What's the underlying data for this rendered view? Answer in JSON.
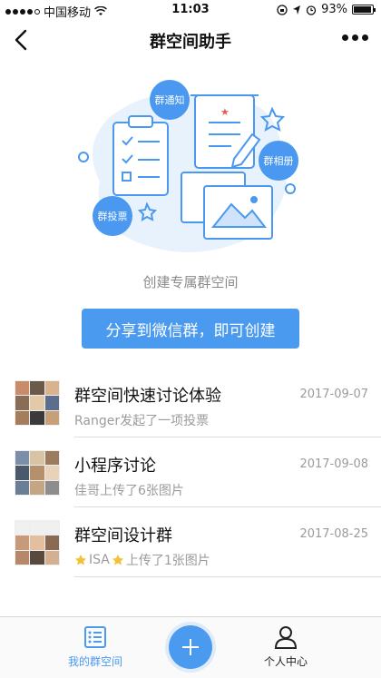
{
  "status_bar": {
    "carrier": "中国移动",
    "time": "11:03",
    "battery": "93%",
    "battery_level": 0.93
  },
  "nav": {
    "title": "群空间助手"
  },
  "illustration": {
    "bubbles": [
      "群通知",
      "群相册",
      "群投票"
    ]
  },
  "caption": "创建专属群空间",
  "share_button": "分享到微信群，即可创建",
  "groups": [
    {
      "title": "群空间快速讨论体验",
      "date": "2017-09-07",
      "subtitle": "Ranger发起了一项投票"
    },
    {
      "title": "小程序讨论",
      "date": "2017-09-08",
      "subtitle": "佳哥上传了6张图片"
    },
    {
      "title": "群空间设计群",
      "date": "2017-08-25",
      "subtitle_name": "ISA",
      "subtitle_action": "上传了1张图片"
    }
  ],
  "tabbar": {
    "my_spaces": "我的群空间",
    "profile": "个人中心"
  },
  "colors": {
    "accent": "#4a9af0",
    "muted_text": "#9b9b9b"
  }
}
